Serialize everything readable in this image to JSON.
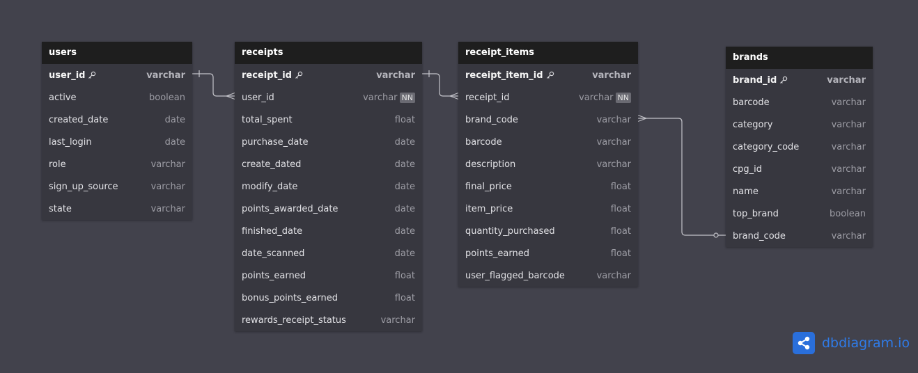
{
  "tables": [
    {
      "name": "users",
      "fields": [
        {
          "name": "user_id",
          "type": "varchar",
          "pk": true
        },
        {
          "name": "active",
          "type": "boolean"
        },
        {
          "name": "created_date",
          "type": "date"
        },
        {
          "name": "last_login",
          "type": "date"
        },
        {
          "name": "role",
          "type": "varchar"
        },
        {
          "name": "sign_up_source",
          "type": "varchar"
        },
        {
          "name": "state",
          "type": "varchar"
        }
      ]
    },
    {
      "name": "receipts",
      "fields": [
        {
          "name": "receipt_id",
          "type": "varchar",
          "pk": true
        },
        {
          "name": "user_id",
          "type": "varchar",
          "nn": "NN"
        },
        {
          "name": "total_spent",
          "type": "float"
        },
        {
          "name": "purchase_date",
          "type": "date"
        },
        {
          "name": "create_dated",
          "type": "date"
        },
        {
          "name": "modify_date",
          "type": "date"
        },
        {
          "name": "points_awarded_date",
          "type": "date"
        },
        {
          "name": "finished_date",
          "type": "date"
        },
        {
          "name": "date_scanned",
          "type": "date"
        },
        {
          "name": "points_earned",
          "type": "float"
        },
        {
          "name": "bonus_points_earned",
          "type": "float"
        },
        {
          "name": "rewards_receipt_status",
          "type": "varchar"
        }
      ]
    },
    {
      "name": "receipt_items",
      "fields": [
        {
          "name": "receipt_item_id",
          "type": "varchar",
          "pk": true
        },
        {
          "name": "receipt_id",
          "type": "varchar",
          "nn": "NN"
        },
        {
          "name": "brand_code",
          "type": "varchar"
        },
        {
          "name": "barcode",
          "type": "varchar"
        },
        {
          "name": "description",
          "type": "varchar"
        },
        {
          "name": "final_price",
          "type": "float"
        },
        {
          "name": "item_price",
          "type": "float"
        },
        {
          "name": "quantity_purchased",
          "type": "float"
        },
        {
          "name": "points_earned",
          "type": "float"
        },
        {
          "name": "user_flagged_barcode",
          "type": "varchar"
        }
      ]
    },
    {
      "name": "brands",
      "fields": [
        {
          "name": "brand_id",
          "type": "varchar",
          "pk": true
        },
        {
          "name": "barcode",
          "type": "varchar"
        },
        {
          "name": "category",
          "type": "varchar"
        },
        {
          "name": "category_code",
          "type": "varchar"
        },
        {
          "name": "cpg_id",
          "type": "varchar"
        },
        {
          "name": "name",
          "type": "varchar"
        },
        {
          "name": "top_brand",
          "type": "boolean"
        },
        {
          "name": "brand_code",
          "type": "varchar"
        }
      ]
    }
  ],
  "relations": [
    {
      "from": "users.user_id",
      "to": "receipts.user_id",
      "cardinality": "one-to-many"
    },
    {
      "from": "receipts.receipt_id",
      "to": "receipt_items.receipt_id",
      "cardinality": "one-to-many"
    },
    {
      "from": "receipt_items.brand_code",
      "to": "brands.brand_code",
      "cardinality": "many-to-zero-or-one"
    }
  ],
  "watermark": {
    "text": "dbdiagram.io",
    "icon": "share-nodes-icon"
  },
  "colors": {
    "background": "#42424c",
    "table_body": "#37373f",
    "table_header": "#1e1e1e",
    "connector": "#c4c4ca",
    "brand": "#2f7be8"
  }
}
